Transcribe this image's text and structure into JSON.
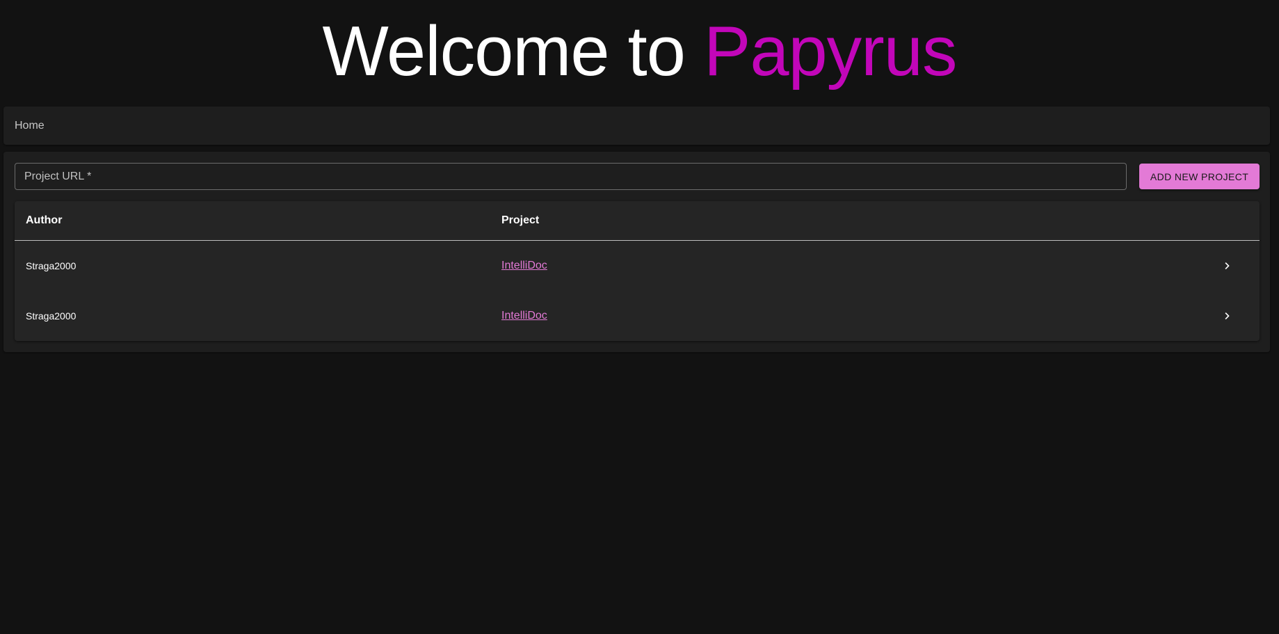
{
  "header": {
    "title_prefix": "Welcome to",
    "title_brand": "Papyrus",
    "brand_color": "#c206b9"
  },
  "breadcrumb": {
    "items": [
      "Home"
    ]
  },
  "project_form": {
    "url_placeholder": "Project URL *",
    "url_value": "",
    "add_button_label": "ADD NEW PROJECT",
    "accent_color": "#e37ad6"
  },
  "projects_table": {
    "columns": [
      "Author",
      "Project"
    ],
    "rows": [
      {
        "author": "Straga2000",
        "project": "IntelliDoc",
        "action_icon": "chevron-right-icon"
      },
      {
        "author": "Straga2000",
        "project": "IntelliDoc",
        "action_icon": "chevron-right-icon"
      }
    ]
  }
}
